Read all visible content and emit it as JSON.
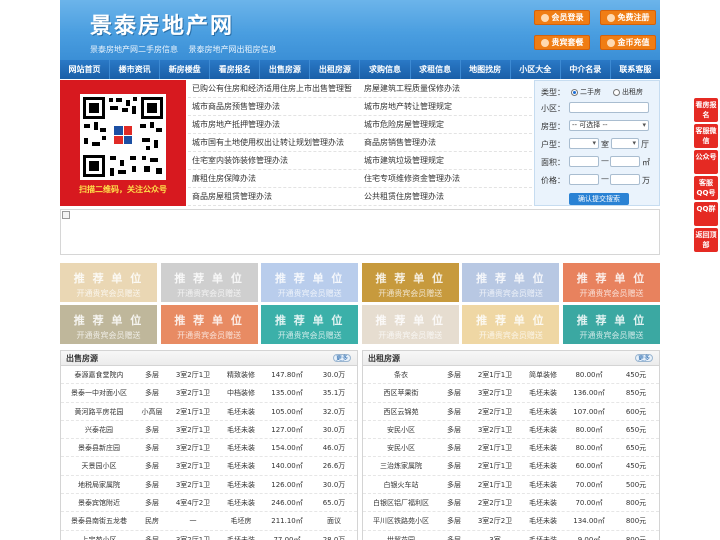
{
  "header": {
    "logo": "景泰房地产网",
    "subtitle_1": "景泰房地产网二手房信息",
    "subtitle_2": "景泰房地产网出租房信息",
    "buttons": [
      "会员登录",
      "免费注册",
      "贵宾套餐",
      "金币充值"
    ]
  },
  "nav": [
    "网站首页",
    "楼市资讯",
    "新房楼盘",
    "看房报名",
    "出售房源",
    "出租房源",
    "求购信息",
    "求租信息",
    "地图找房",
    "小区大全",
    "中介名录",
    "联系客服"
  ],
  "qr": {
    "caption": "扫描二维码，关注公众号"
  },
  "policy_links": [
    [
      "已购公有住房和经济适用住房上市出售管理暂",
      "房屋建筑工程质量保修办法"
    ],
    [
      "城市商品房预售管理办法",
      "城市房地产转让管理规定"
    ],
    [
      "城市房地产抵押管理办法",
      "城市危险房屋管理规定"
    ],
    [
      "城市国有土地使用权出让转让规划管理办法",
      "商品房销售管理办法"
    ],
    [
      "住宅室内装饰装修管理办法",
      "城市建筑垃圾管理规定"
    ],
    [
      "廉租住房保障办法",
      "住宅专项维修资金管理办法"
    ],
    [
      "商品房屋租赁管理办法",
      "公共租赁住房管理办法"
    ]
  ],
  "search": {
    "type_label": "类型：",
    "option_sale": "二手房",
    "option_rent": "出租房",
    "community_label": "小区：",
    "property_label": "房型：",
    "property_value": "-- 可选择 --",
    "layout_label": "户型：",
    "room_unit": "室",
    "hall_unit": "厅",
    "area_label": "面积：",
    "area_unit": "㎡",
    "price_label": "价格：",
    "price_unit": "万",
    "submit": "确认提交搜索"
  },
  "ads": {
    "title": "推 荐 单 位",
    "subtitle": "开通贵宾会员赠送",
    "colors": [
      "#ead7b4",
      "#cfcfcf",
      "#b9cdec",
      "#c79a3d",
      "#b8c8e3",
      "#e8825e",
      "#bfb79b",
      "#e88b63",
      "#3bb0a9",
      "#e6ddd0",
      "#efd7a4",
      "#3ba8a2"
    ]
  },
  "sale": {
    "title": "出售房源",
    "more": "更多",
    "rows": [
      [
        "泰源嘉食堂院内",
        "多层",
        "3室2厅1卫",
        "精致装修",
        "147.80㎡",
        "30.0万"
      ],
      [
        "景泰一中对面小区",
        "多层",
        "3室2厅1卫",
        "中档装修",
        "135.00㎡",
        "35.1万"
      ],
      [
        "黄河路平房花园",
        "小高层",
        "2室1厅1卫",
        "毛坯未装",
        "105.00㎡",
        "32.0万"
      ],
      [
        "兴泰花园",
        "多层",
        "3室2厅1卫",
        "毛坯未装",
        "127.00㎡",
        "30.0万"
      ],
      [
        "景泰县新庄园",
        "多层",
        "3室2厅1卫",
        "毛坯未装",
        "154.00㎡",
        "46.0万"
      ],
      [
        "天景园小区",
        "多层",
        "3室2厅1卫",
        "毛坯未装",
        "140.00㎡",
        "26.6万"
      ],
      [
        "地税局家属院",
        "多层",
        "3室2厅1卫",
        "毛坯未装",
        "126.00㎡",
        "30.0万"
      ],
      [
        "景泰宾馆附近",
        "多层",
        "4室4厅2卫",
        "毛坯未装",
        "246.00㎡",
        "65.0万"
      ],
      [
        "景泰县南街五龙巷",
        "民房",
        "一",
        "毛坯房",
        "211.10㎡",
        "面议"
      ],
      [
        "上宝苑小区",
        "多层",
        "3室2厅1卫",
        "毛坯未装",
        "77.00㎡",
        "28.0万"
      ]
    ]
  },
  "rent": {
    "title": "出租房源",
    "more": "更多",
    "rows": [
      [
        "条衣",
        "多层",
        "2室1厅1卫",
        "简单装修",
        "80.00㎡",
        "450元"
      ],
      [
        "西区苹果街",
        "多层",
        "3室2厅1卫",
        "毛坯未装",
        "136.00㎡",
        "850元"
      ],
      [
        "西区云锦苑",
        "多层",
        "2室2厅1卫",
        "毛坯未装",
        "107.00㎡",
        "600元"
      ],
      [
        "安民小区",
        "多层",
        "3室2厅1卫",
        "毛坯未装",
        "80.00㎡",
        "650元"
      ],
      [
        "安民小区",
        "多层",
        "2室1厅1卫",
        "毛坯未装",
        "80.00㎡",
        "650元"
      ],
      [
        "三治炼家属院",
        "多层",
        "2室1厅1卫",
        "毛坯未装",
        "60.00㎡",
        "450元"
      ],
      [
        "白银火车站",
        "多层",
        "2室1厅1卫",
        "毛坯未装",
        "70.00㎡",
        "500元"
      ],
      [
        "白银区铝厂福利区",
        "多层",
        "2室2厅1卫",
        "毛坯未装",
        "70.00㎡",
        "800元"
      ],
      [
        "平川区铁路苑小区",
        "多层",
        "3室2厅2卫",
        "毛坯未装",
        "134.00㎡",
        "800元"
      ],
      [
        "世贸花园",
        "多层",
        "3室",
        "毛坯未装",
        "9.00㎡",
        "800元"
      ]
    ]
  },
  "float": [
    "看房报名",
    "客服微信",
    "公众号",
    "客服QQ号",
    "QQ群",
    "返回顶部"
  ]
}
